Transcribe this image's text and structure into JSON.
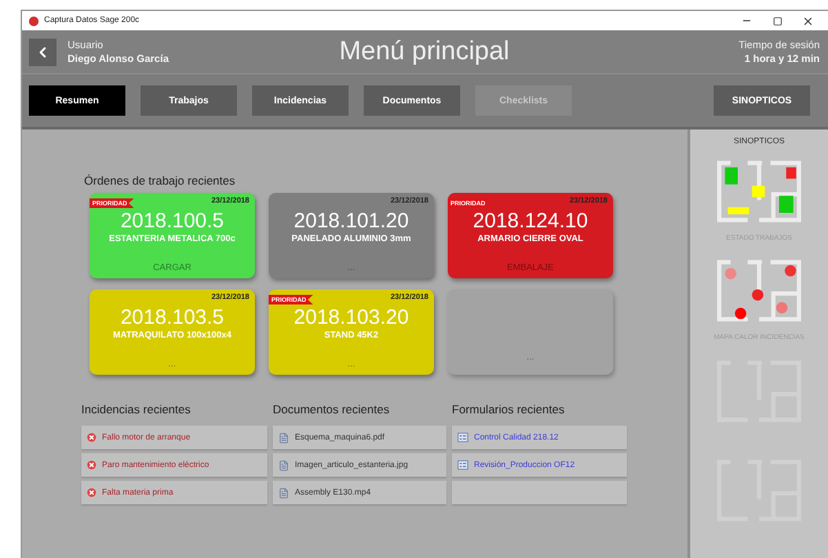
{
  "window": {
    "title": "Captura Datos Sage 200c"
  },
  "header": {
    "user_label": "Usuario",
    "user_name": "Diego Alonso García",
    "title": "Menú principal",
    "session_label": "Tiempo de sesión",
    "session_value": "1 hora y 12 min"
  },
  "tabs": [
    {
      "label": "Resumen",
      "selected": true,
      "disabled": false
    },
    {
      "label": "Trabajos",
      "selected": false,
      "disabled": false
    },
    {
      "label": "Incidencias",
      "selected": false,
      "disabled": false
    },
    {
      "label": "Documentos",
      "selected": false,
      "disabled": false
    },
    {
      "label": "Checklists",
      "selected": false,
      "disabled": true
    }
  ],
  "sinopticos_button": "SINOPTICOS",
  "orders_title": "Órdenes de trabajo recientes",
  "orders": [
    {
      "kind": "order",
      "priority": true,
      "priority_label": "PRIORIDAD",
      "date": "23/12/2018",
      "code": "2018.100.5",
      "description": "ESTANTERIA METALICA 700c",
      "step": "CARGAR",
      "color": "#4cdc4c"
    },
    {
      "kind": "order",
      "priority": false,
      "date": "23/12/2018",
      "code": "2018.101.20",
      "description": "PANELADO ALUMINIO 3mm",
      "step": "...",
      "color": "#7f7f7f"
    },
    {
      "kind": "order",
      "priority": true,
      "priority_label": "PRIORIDAD",
      "date": "23/12/2018",
      "code": "2018.124.10",
      "description": "ARMARIO CIERRE OVAL",
      "step": "EMBALAJE",
      "color": "#d41b22"
    },
    {
      "kind": "order",
      "priority": false,
      "date": "23/12/2018",
      "code": "2018.103.5",
      "description": "MATRAQUILATO 100x100x4",
      "step": "...",
      "color": "#d6cc00"
    },
    {
      "kind": "order",
      "priority": true,
      "priority_label": "PRIORIDAD",
      "date": "23/12/2018",
      "code": "2018.103.20",
      "description": "STAND 45K2",
      "step": "...",
      "color": "#d6cc00"
    },
    {
      "kind": "empty",
      "step": "..."
    }
  ],
  "lists": [
    {
      "kind": "incident",
      "title": "Incidencias recientes",
      "items": [
        "Fallo motor de arranque",
        "Paro mantenimiento eléctrico",
        "Falta materia prima"
      ]
    },
    {
      "kind": "document",
      "title": "Documentos recientes",
      "items": [
        "Esquema_maquina6.pdf",
        "Imagen_articulo_estanteria.jpg",
        "Assembly E130.mp4"
      ]
    },
    {
      "kind": "form",
      "title": "Formularios recientes",
      "items": [
        "Control Calidad 218.12",
        "Revisión_Produccion OF12"
      ]
    }
  ],
  "sidebar": {
    "title": "SINOPTICOS",
    "items": [
      {
        "kind": "status",
        "label": "ESTADO TRABAJOS"
      },
      {
        "kind": "heatmap",
        "label": "MAPA CALOR INCIDENCIAS"
      },
      {
        "kind": "blank"
      },
      {
        "kind": "blank"
      }
    ]
  }
}
